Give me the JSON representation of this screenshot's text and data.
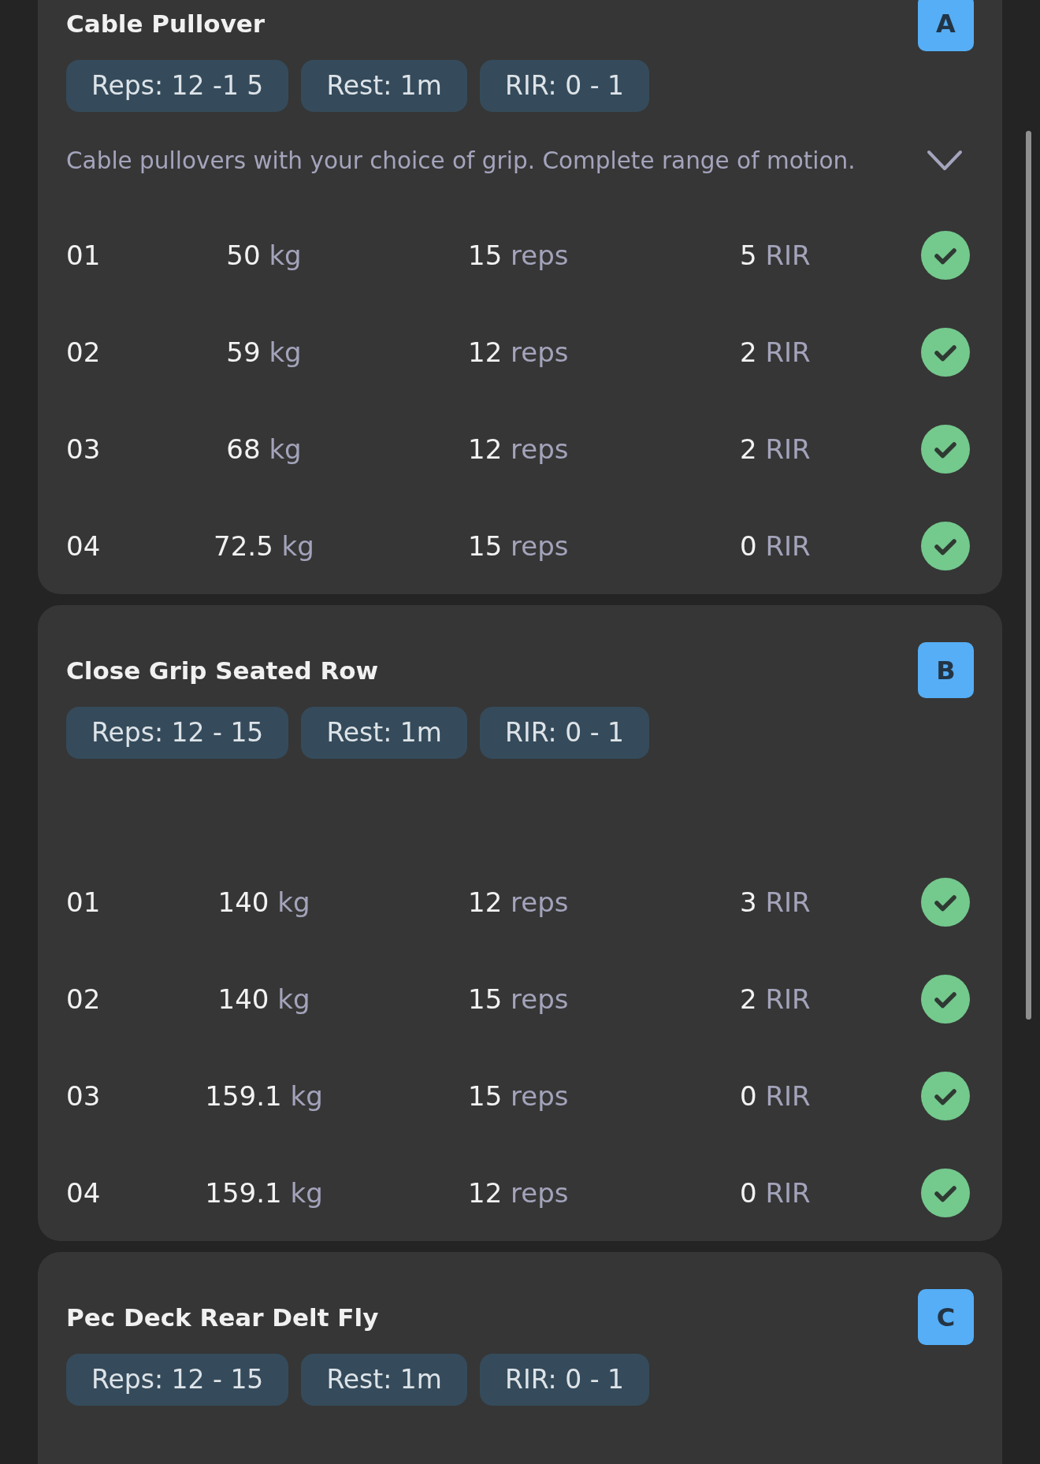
{
  "exercises": [
    {
      "title": "Cable Pullover",
      "letter": "A",
      "chips": [
        "Reps: 12 -1 5",
        "Rest: 1m",
        "RIR: 0 - 1"
      ],
      "description": "Cable pullovers with your choice of grip. Complete range of motion.",
      "sets": [
        {
          "number": "01",
          "weight": "50",
          "weight_unit": "kg",
          "reps": "15",
          "reps_unit": "reps",
          "rir": "5",
          "rir_unit": "RIR",
          "done": true
        },
        {
          "number": "02",
          "weight": "59",
          "weight_unit": "kg",
          "reps": "12",
          "reps_unit": "reps",
          "rir": "2",
          "rir_unit": "RIR",
          "done": true
        },
        {
          "number": "03",
          "weight": "68",
          "weight_unit": "kg",
          "reps": "12",
          "reps_unit": "reps",
          "rir": "2",
          "rir_unit": "RIR",
          "done": true
        },
        {
          "number": "04",
          "weight": "72.5",
          "weight_unit": "kg",
          "reps": "15",
          "reps_unit": "reps",
          "rir": "0",
          "rir_unit": "RIR",
          "done": true
        }
      ]
    },
    {
      "title": "Close Grip Seated Row",
      "letter": "B",
      "chips": [
        "Reps: 12 - 15",
        "Rest: 1m",
        "RIR: 0 - 1"
      ],
      "sets": [
        {
          "number": "01",
          "weight": "140",
          "weight_unit": "kg",
          "reps": "12",
          "reps_unit": "reps",
          "rir": "3",
          "rir_unit": "RIR",
          "done": true
        },
        {
          "number": "02",
          "weight": "140",
          "weight_unit": "kg",
          "reps": "15",
          "reps_unit": "reps",
          "rir": "2",
          "rir_unit": "RIR",
          "done": true
        },
        {
          "number": "03",
          "weight": "159.1",
          "weight_unit": "kg",
          "reps": "15",
          "reps_unit": "reps",
          "rir": "0",
          "rir_unit": "RIR",
          "done": true
        },
        {
          "number": "04",
          "weight": "159.1",
          "weight_unit": "kg",
          "reps": "12",
          "reps_unit": "reps",
          "rir": "0",
          "rir_unit": "RIR",
          "done": true
        }
      ]
    },
    {
      "title": "Pec Deck Rear Delt Fly",
      "letter": "C",
      "chips": [
        "Reps: 12 - 15",
        "Rest: 1m",
        "RIR: 0 - 1"
      ]
    }
  ]
}
